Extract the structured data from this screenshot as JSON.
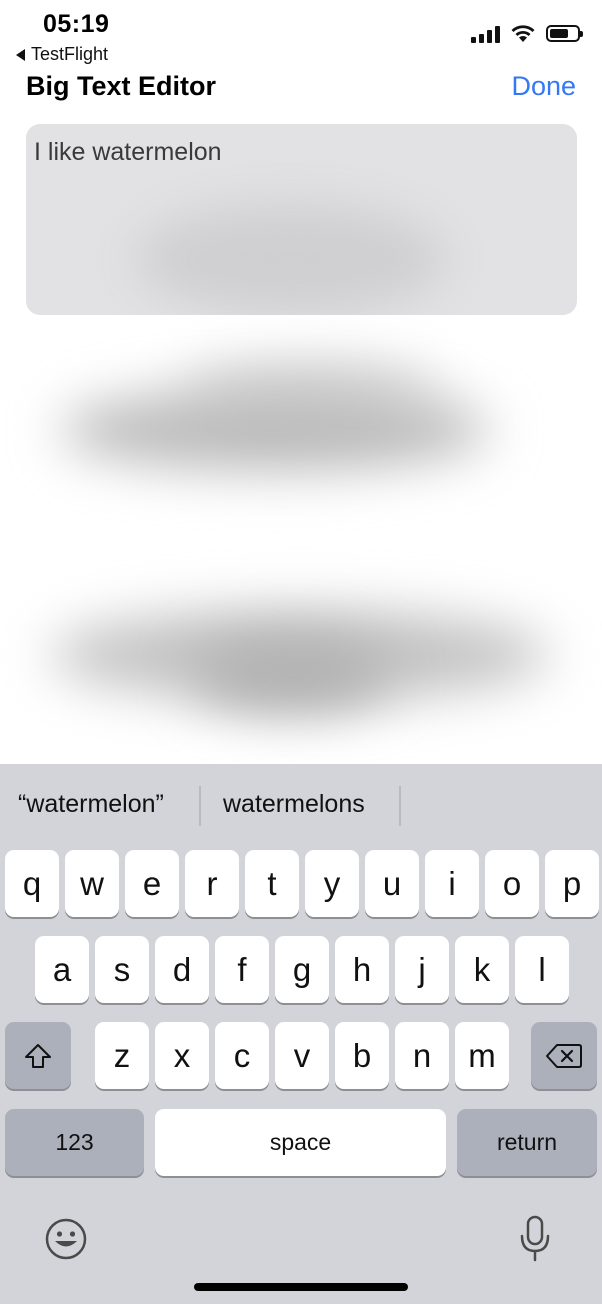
{
  "status_bar": {
    "time": "05:19",
    "back_app": "TestFlight"
  },
  "nav": {
    "title": "Big Text Editor",
    "done_label": "Done"
  },
  "editor": {
    "text": "I like watermelon"
  },
  "keyboard": {
    "suggestions": [
      "“watermelon”",
      "watermelons"
    ],
    "row1": [
      "q",
      "w",
      "e",
      "r",
      "t",
      "y",
      "u",
      "i",
      "o",
      "p"
    ],
    "row2": [
      "a",
      "s",
      "d",
      "f",
      "g",
      "h",
      "j",
      "k",
      "l"
    ],
    "row3": [
      "z",
      "x",
      "c",
      "v",
      "b",
      "n",
      "m"
    ],
    "numbers_label": "123",
    "space_label": "space",
    "return_label": "return"
  },
  "colors": {
    "accent": "#3478f6",
    "keyboard_bg": "#d2d4d9",
    "key_dark": "#abb0ba"
  }
}
